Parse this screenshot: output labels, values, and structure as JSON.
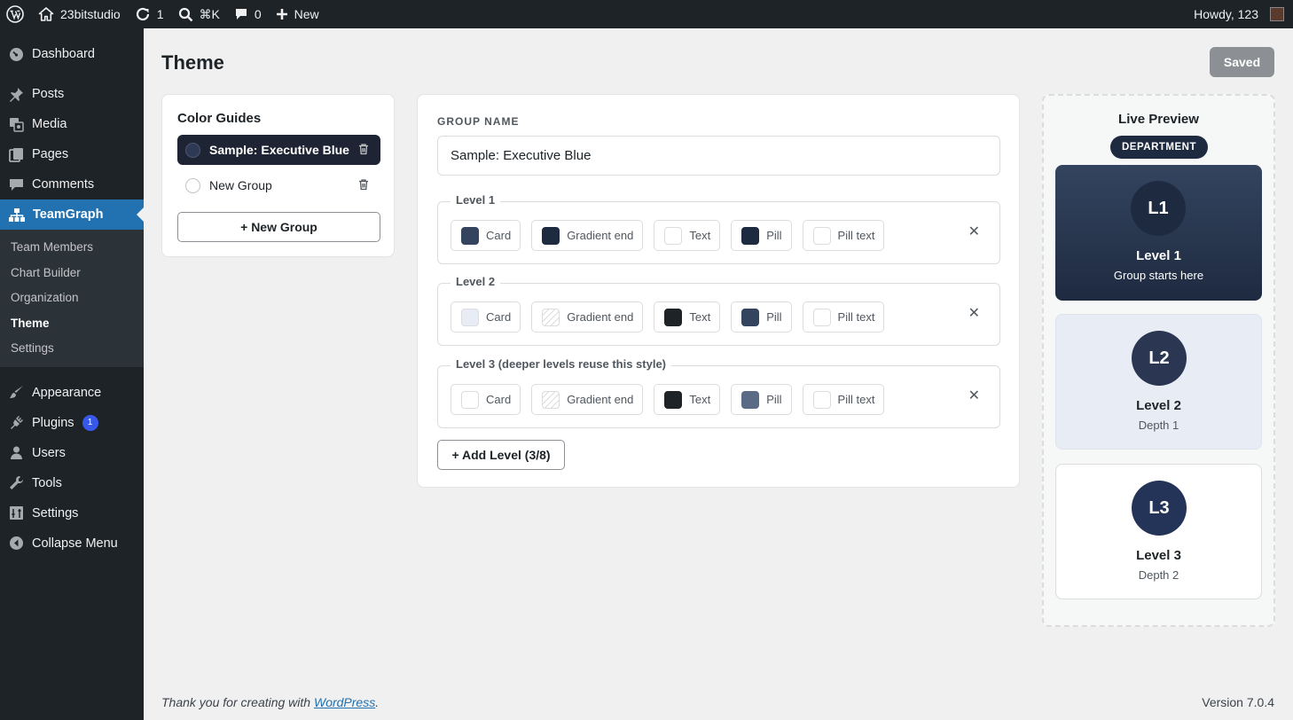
{
  "adminbar": {
    "site_name": "23bitstudio",
    "updates_count": "1",
    "search_shortcut": "⌘K",
    "comments_count": "0",
    "new_label": "New",
    "howdy": "Howdy, 123"
  },
  "sidebar": {
    "items": [
      {
        "label": "Dashboard",
        "icon": "dashboard-icon"
      },
      {
        "label": "Posts",
        "icon": "pin-icon"
      },
      {
        "label": "Media",
        "icon": "media-icon"
      },
      {
        "label": "Pages",
        "icon": "pages-icon"
      },
      {
        "label": "Comments",
        "icon": "comment-icon"
      },
      {
        "label": "TeamGraph",
        "icon": "org-chart-icon"
      }
    ],
    "submenu": [
      "Team Members",
      "Chart Builder",
      "Organization",
      "Theme",
      "Settings"
    ],
    "items_lower": [
      {
        "label": "Appearance",
        "icon": "brush-icon"
      },
      {
        "label": "Plugins",
        "icon": "plugin-icon",
        "badge": "1"
      },
      {
        "label": "Users",
        "icon": "user-icon"
      },
      {
        "label": "Tools",
        "icon": "wrench-icon"
      },
      {
        "label": "Settings",
        "icon": "settings-icon"
      },
      {
        "label": "Collapse Menu",
        "icon": "collapse-icon"
      }
    ]
  },
  "page": {
    "title": "Theme",
    "saved_label": "Saved"
  },
  "guides": {
    "title": "Color Guides",
    "items": [
      {
        "label": "Sample: Executive Blue",
        "color": "#2e3a55",
        "selected": true
      },
      {
        "label": "New Group",
        "color": "#ffffff",
        "selected": false
      }
    ],
    "new_group_label": "+ New Group"
  },
  "editor": {
    "group_name_label": "GROUP NAME",
    "group_name_value": "Sample: Executive Blue",
    "levels": [
      {
        "legend": "Level 1",
        "swatches": [
          {
            "label": "Card",
            "color": "#34445f"
          },
          {
            "label": "Gradient end",
            "color": "#1e2a40"
          },
          {
            "label": "Text",
            "color": "#ffffff"
          },
          {
            "label": "Pill",
            "color": "#1e2a40"
          },
          {
            "label": "Pill text",
            "color": "#ffffff"
          }
        ]
      },
      {
        "legend": "Level 2",
        "swatches": [
          {
            "label": "Card",
            "color": "#e8edf5"
          },
          {
            "label": "Gradient end",
            "color": "transparent"
          },
          {
            "label": "Text",
            "color": "#1d2327"
          },
          {
            "label": "Pill",
            "color": "#34445f"
          },
          {
            "label": "Pill text",
            "color": "#ffffff"
          }
        ]
      },
      {
        "legend": "Level 3 (deeper levels reuse this style)",
        "swatches": [
          {
            "label": "Card",
            "color": "#ffffff"
          },
          {
            "label": "Gradient end",
            "color": "transparent"
          },
          {
            "label": "Text",
            "color": "#1d2327"
          },
          {
            "label": "Pill",
            "color": "#5c6b85"
          },
          {
            "label": "Pill text",
            "color": "#ffffff"
          }
        ]
      }
    ],
    "remove_symbol": "✕",
    "add_level_label": "+ Add Level (3/8)"
  },
  "preview": {
    "title": "Live Preview",
    "pill": "DEPARTMENT",
    "cards": [
      {
        "initials": "L1",
        "title": "Level 1",
        "subtitle": "Group starts here"
      },
      {
        "initials": "L2",
        "title": "Level 2",
        "subtitle": "Depth 1"
      },
      {
        "initials": "L3",
        "title": "Level 3",
        "subtitle": "Depth 2"
      }
    ]
  },
  "footer": {
    "thanks_prefix": "Thank you for creating with ",
    "link": "WordPress",
    "thanks_suffix": ".",
    "version": "Version 7.0.4"
  }
}
